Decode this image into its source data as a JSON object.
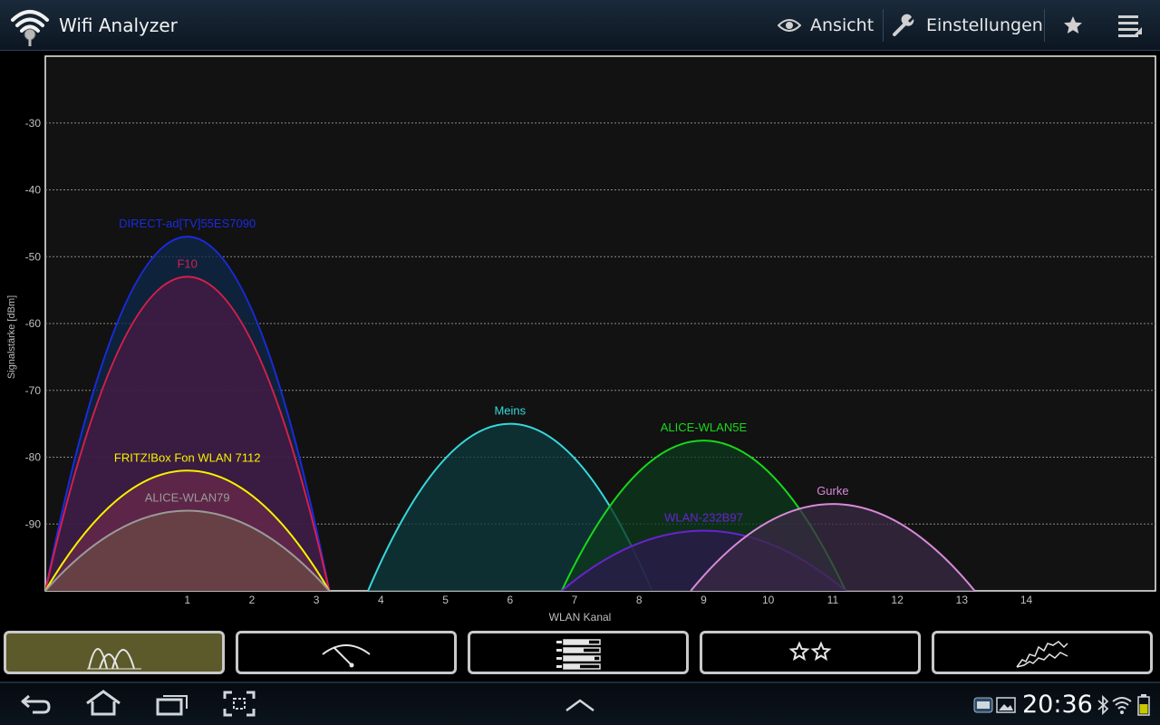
{
  "app": {
    "title": "Wifi Analyzer",
    "actions": {
      "view_label": "Ansicht",
      "settings_label": "Einstellungen"
    }
  },
  "chart_data": {
    "type": "area",
    "xlabel": "WLAN Kanal",
    "ylabel": "Signalstärke [dBm]",
    "x_ticks": [
      1,
      2,
      3,
      4,
      5,
      6,
      7,
      8,
      9,
      10,
      11,
      12,
      13,
      14
    ],
    "y_ticks": [
      -30,
      -40,
      -50,
      -60,
      -70,
      -80,
      -90
    ],
    "ylim": [
      -100,
      -20
    ],
    "xlim": [
      -1.2,
      16
    ],
    "grid": true,
    "series": [
      {
        "name": "DIRECT-ad[TV]55ES7090",
        "channel": 1,
        "signal_dbm": -47,
        "color": "#1a2be0",
        "fill": "#0e2a4a"
      },
      {
        "name": "F10",
        "channel": 1,
        "signal_dbm": -53,
        "color": "#d81e4a",
        "fill": "#4a1a44"
      },
      {
        "name": "FRITZ!Box Fon WLAN 7112",
        "channel": 1,
        "signal_dbm": -82,
        "color": "#f4f400",
        "fill": "#6a2a4a"
      },
      {
        "name": "ALICE-WLAN79",
        "channel": 1,
        "signal_dbm": -88,
        "color": "#9a9a9a",
        "fill": "#6a4a44"
      },
      {
        "name": "Meins",
        "channel": 6,
        "signal_dbm": -75,
        "color": "#36d8dc",
        "fill": "#0e3a3c"
      },
      {
        "name": "ALICE-WLAN5E",
        "channel": 9,
        "signal_dbm": -77.5,
        "color": "#18d81c",
        "fill": "#0c3a1e"
      },
      {
        "name": "WLAN-232B97",
        "channel": 9,
        "signal_dbm": -91,
        "color": "#6a22d0",
        "fill": "#2c1a4e"
      },
      {
        "name": "Gurke",
        "channel": 11,
        "signal_dbm": -87,
        "color": "#d88ad8",
        "fill": "#3a2a44"
      }
    ]
  },
  "tabs": [
    {
      "name": "channel-graph",
      "active": true
    },
    {
      "name": "signal-meter",
      "active": false
    },
    {
      "name": "ap-list",
      "active": false
    },
    {
      "name": "channel-rating",
      "active": false
    },
    {
      "name": "time-graph",
      "active": false
    }
  ],
  "status": {
    "time": "20:36"
  }
}
